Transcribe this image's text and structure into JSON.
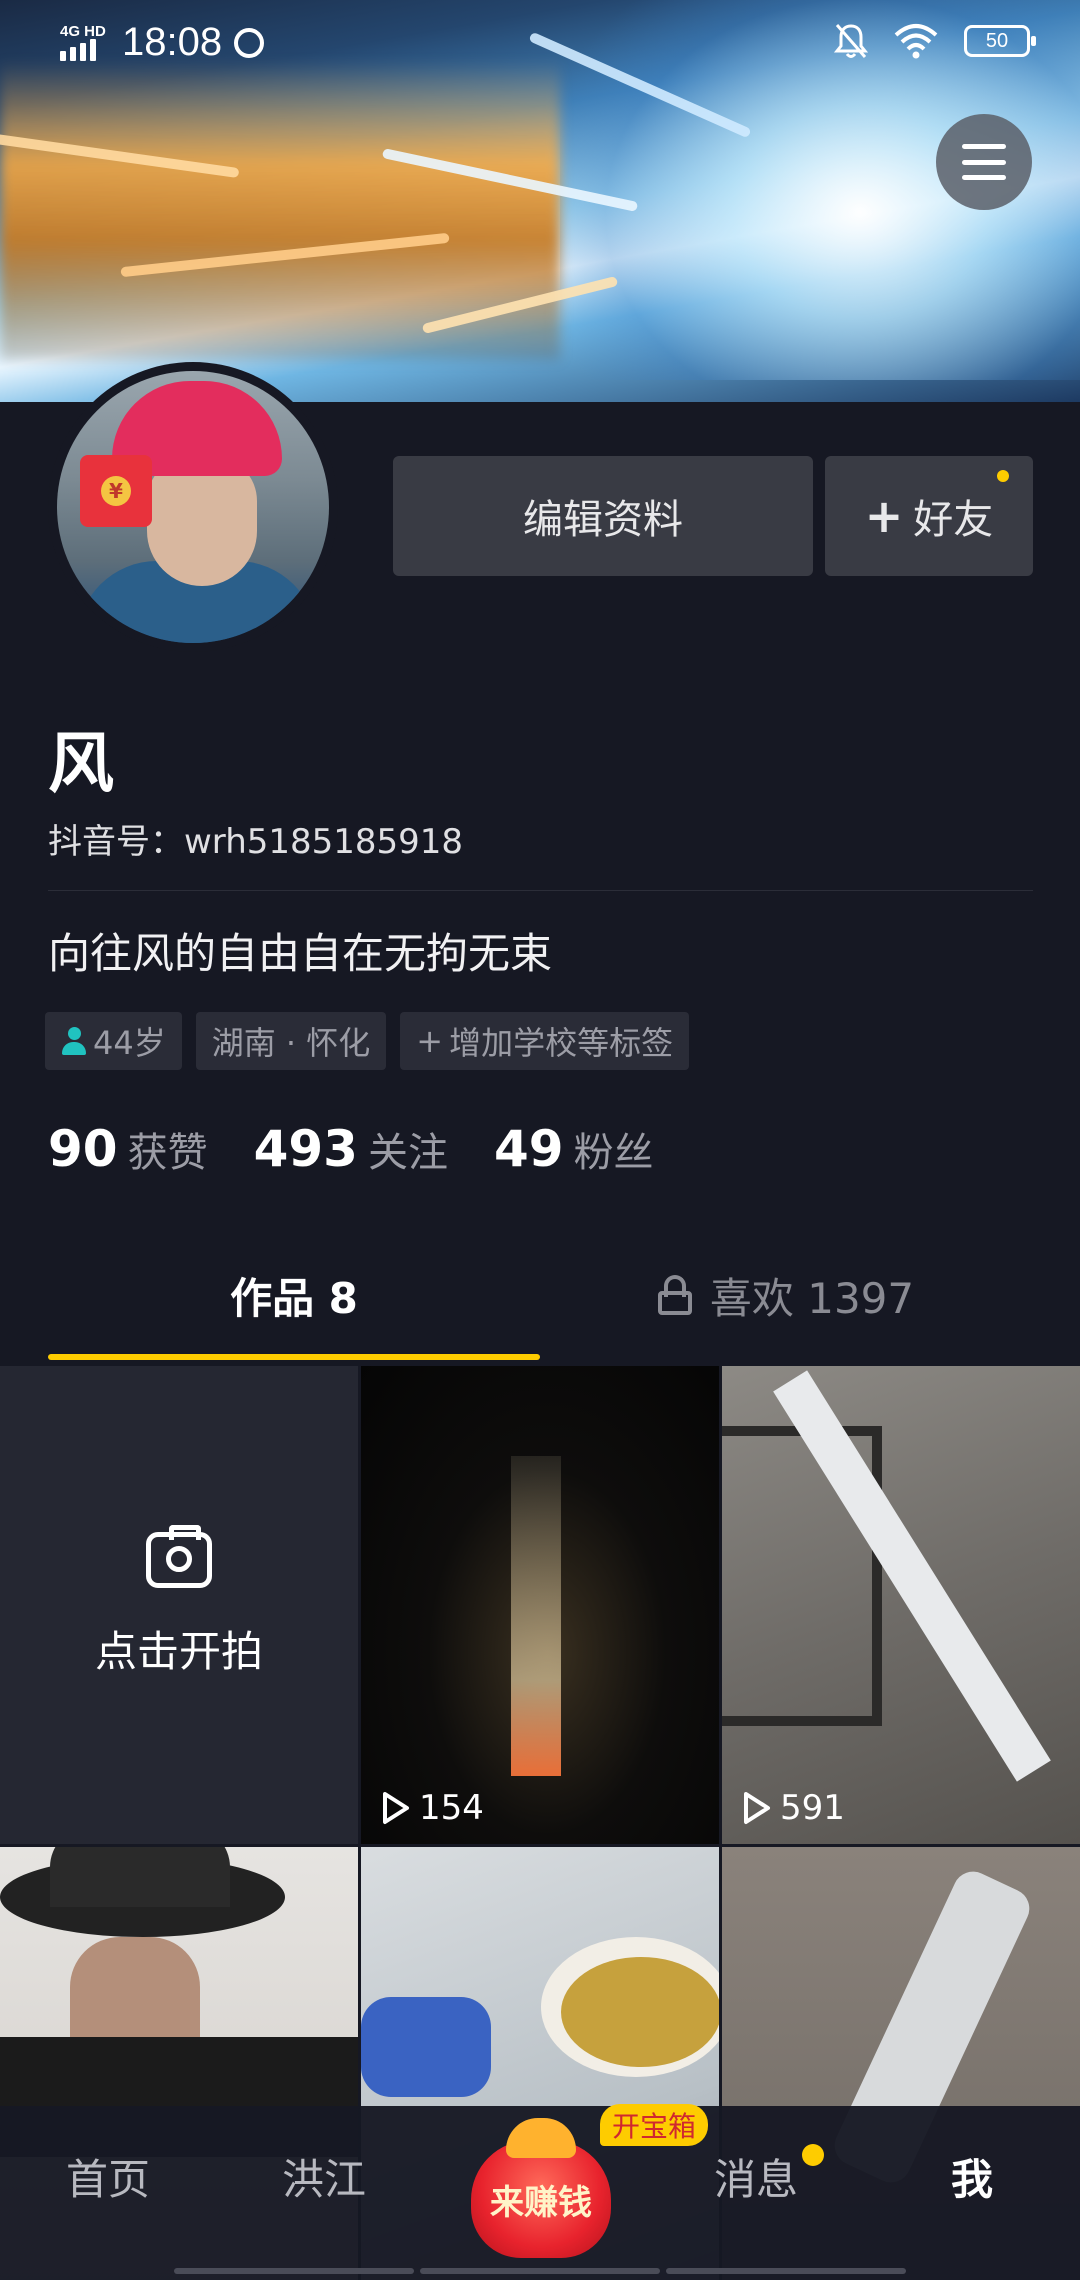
{
  "status_bar": {
    "network": "4G HD",
    "time": "18:08",
    "battery": "50"
  },
  "profile": {
    "name": "风",
    "douyin_id": "抖音号：wrh5185185918",
    "bio": "向往风的自由自在无拘无束",
    "edit_button": "编辑资料",
    "add_friend_button": "好友",
    "add_friend_plus": "+",
    "redpacket_symbol": "¥"
  },
  "tags": [
    {
      "label": "44岁",
      "icon": "person-icon"
    },
    {
      "label": "湖南 · 怀化"
    },
    {
      "label": "增加学校等标签",
      "icon": "plus-icon",
      "prefix": "+"
    }
  ],
  "stats": [
    {
      "value": "90",
      "label": "获赞"
    },
    {
      "value": "493",
      "label": "关注"
    },
    {
      "value": "49",
      "label": "粉丝"
    }
  ],
  "tabs": {
    "works": "作品 8",
    "likes": "喜欢 1397"
  },
  "grid": {
    "shoot_label": "点击开拍",
    "videos": [
      {
        "plays": "154"
      },
      {
        "plays": "591"
      },
      {
        "plays": ""
      },
      {
        "plays": ""
      },
      {
        "plays": ""
      }
    ]
  },
  "bottom_nav": {
    "home": "首页",
    "city": "洪江",
    "earn": "来赚钱",
    "treasure": "开宝箱",
    "messages": "消息",
    "me": "我"
  },
  "colors": {
    "background": "#161823",
    "accent_yellow": "#fecc00",
    "button_bg": "#393b44",
    "tag_bg": "#2a2c37",
    "muted_text": "#9c9da6"
  }
}
